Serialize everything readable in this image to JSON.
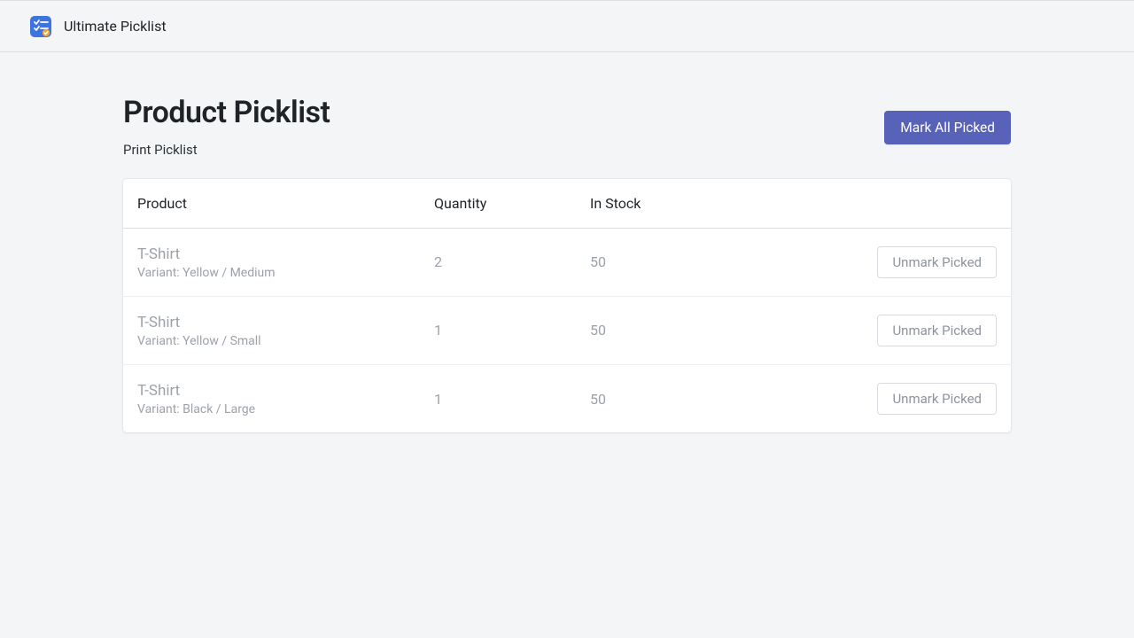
{
  "header": {
    "app_title": "Ultimate Picklist"
  },
  "page": {
    "title": "Product Picklist",
    "print_label": "Print Picklist",
    "mark_all_label": "Mark All Picked"
  },
  "table": {
    "columns": {
      "product": "Product",
      "quantity": "Quantity",
      "in_stock": "In Stock"
    },
    "unmark_label": "Unmark Picked",
    "variant_prefix": "Variant: ",
    "rows": [
      {
        "name": "T-Shirt",
        "variant": "Yellow / Medium",
        "quantity": "2",
        "in_stock": "50"
      },
      {
        "name": "T-Shirt",
        "variant": "Yellow / Small",
        "quantity": "1",
        "in_stock": "50"
      },
      {
        "name": "T-Shirt",
        "variant": "Black / Large",
        "quantity": "1",
        "in_stock": "50"
      }
    ]
  },
  "colors": {
    "primary": "#5862b9",
    "muted_text": "#9ca2a9",
    "border": "#d9dde1",
    "bg": "#f4f5f6"
  }
}
